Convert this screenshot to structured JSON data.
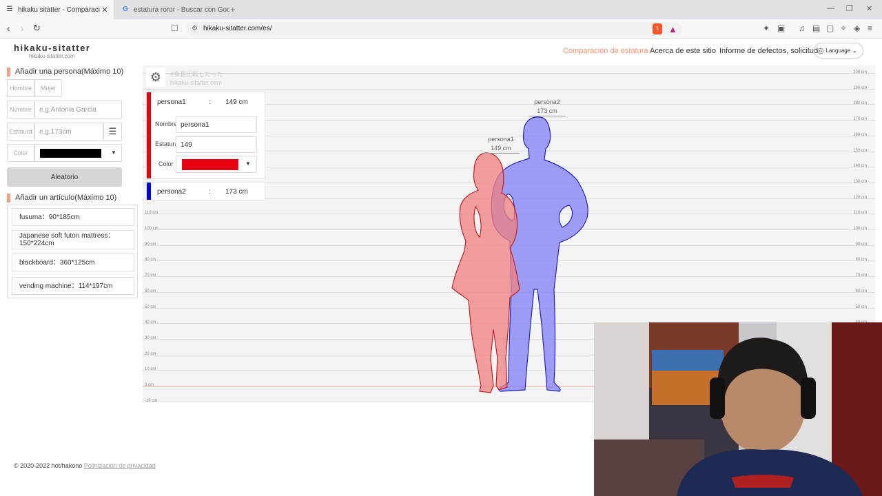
{
  "browser": {
    "tabs": [
      {
        "title": "hikaku sitatter - Comparación de",
        "active": true
      },
      {
        "title": "estatura roror - Buscar con Google",
        "active": false
      }
    ],
    "new_tab": "+",
    "url": "hikaku-sitatter.com/es/",
    "brave_badge": "1"
  },
  "site": {
    "logo": "hikaku-sitatter",
    "logo_sub": "hikaku-sitatter.com",
    "nav": [
      {
        "label": "Comparación de estatura",
        "active": true
      },
      {
        "label": "Acerca de este sitio",
        "active": false
      },
      {
        "label": "Informe de defectos, solicitud",
        "active": false
      }
    ],
    "language": "Language"
  },
  "add_person": {
    "title": "Añadir una persona(Máximo 10)",
    "gender_male": "Hombre",
    "gender_female": "Mujer",
    "name_label": "Nombre",
    "name_placeholder": "e.g.Antonia Garcia",
    "height_label": "Estatura",
    "height_placeholder": "e.g.173cm",
    "color_label": "Color",
    "color_value": "#000000",
    "random_button": "Aleatorio"
  },
  "add_item": {
    "title": "Añadir un artículo(Máximo 10)",
    "items": [
      "fusuma：90*185cm",
      "Japanese soft futon mattress：150*224cm",
      "blackboard：360*125cm",
      "vending machine：114*197cm"
    ]
  },
  "chart": {
    "watermark_line1": "#身長比較したった",
    "watermark_line2": "hikaku-sitatter.com",
    "right_ticks": [
      "200 cm",
      "190 cm",
      "180 cm",
      "170 cm",
      "160 cm",
      "150 cm",
      "140 cm",
      "130 cm",
      "120 cm",
      "110 cm",
      "100 cm",
      "90 cm",
      "80 cm",
      "70 cm",
      "60 cm",
      "50 cm",
      "40 cm"
    ],
    "left_ticks": [
      "110 cm",
      "100 cm",
      "90 cm",
      "80 cm",
      "70 cm",
      "60 cm",
      "50 cm",
      "40 cm",
      "30 cm",
      "20 cm",
      "10 cm",
      "0 cm",
      "-10 cm"
    ]
  },
  "persons": [
    {
      "name": "persona1",
      "height": "149 cm",
      "height_value": 149,
      "color": "#e60012",
      "silhouette_fill": "#f08080",
      "edit": {
        "name_label": "Nombre",
        "name_value": "persona1",
        "height_label": "Estatura",
        "height_value": "149",
        "color_label": "Color"
      }
    },
    {
      "name": "persona2",
      "height": "173 cm",
      "height_value": 173,
      "color": "#0000e6",
      "silhouette_fill": "#8080f8"
    }
  ],
  "card_separator": ":",
  "footer": {
    "copyright": "© 2020-2022 hot/hakono",
    "privacy": "Polinización de privacidad"
  }
}
